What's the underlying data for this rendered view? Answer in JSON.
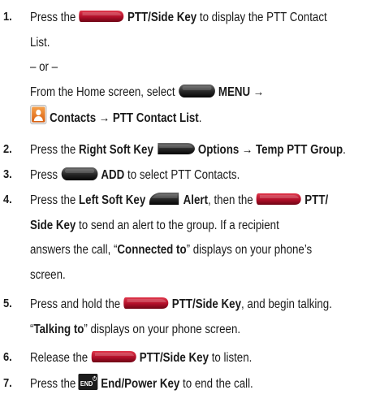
{
  "steps": [
    {
      "number": "1.",
      "lines": {
        "l1_pre": "Press the",
        "l1_key": "PTT/Side Key",
        "l1_post": "to display the PTT Contact",
        "l2": "List.",
        "l3": "– or –",
        "l4_pre": "From the Home screen, select",
        "l4_key": "MENU →",
        "l5_key": "Contacts → PTT Contact List",
        "l5_post": "."
      }
    },
    {
      "number": "2.",
      "lines": {
        "l1_pre": "Press the",
        "l1_key1": "Right Soft Key",
        "l1_key2": "Options → Temp PTT Group",
        "l1_post": "."
      }
    },
    {
      "number": "3.",
      "lines": {
        "l1_pre": "Press",
        "l1_key": "ADD",
        "l1_post": "to select PTT Contacts."
      }
    },
    {
      "number": "4.",
      "lines": {
        "l1_pre": "Press the",
        "l1_key1": "Left Soft Key",
        "l1_key2": "Alert",
        "l1_mid": ", then the",
        "l1_key3": "PTT/",
        "l2_key": "Side Key",
        "l2_post": "to send an alert to the group. If a recipient",
        "l3": "answers the call, “",
        "l3_key": "Connected to",
        "l3_post": "” displays on your phone’s",
        "l4": "screen."
      }
    },
    {
      "number": "5.",
      "lines": {
        "l1_pre": "Press and hold the",
        "l1_key": "PTT/Side Key",
        "l1_post": ", and begin talking.",
        "l2_open": "“",
        "l2_key": "Talking to",
        "l2_post": "” displays on your phone screen."
      }
    },
    {
      "number": "6.",
      "lines": {
        "l1_pre": "Release the",
        "l1_key": "PTT/Side Key",
        "l1_post": "to listen."
      }
    },
    {
      "number": "7.",
      "lines": {
        "l1_pre": "Press the",
        "l1_icon_text": "END",
        "l1_key": "End/Power Key",
        "l1_post": "to end the call."
      }
    }
  ],
  "colors": {
    "ptt_key": "#b2102a",
    "dark_key": "#1e1e1e",
    "contacts_icon": "#e8731c"
  },
  "icons": {
    "ptt": "ptt-side-key-icon",
    "menu": "menu-key-icon",
    "contacts": "contacts-app-icon",
    "right_soft": "right-soft-key-icon",
    "left_soft": "left-soft-key-icon",
    "end": "end-power-key-icon"
  }
}
